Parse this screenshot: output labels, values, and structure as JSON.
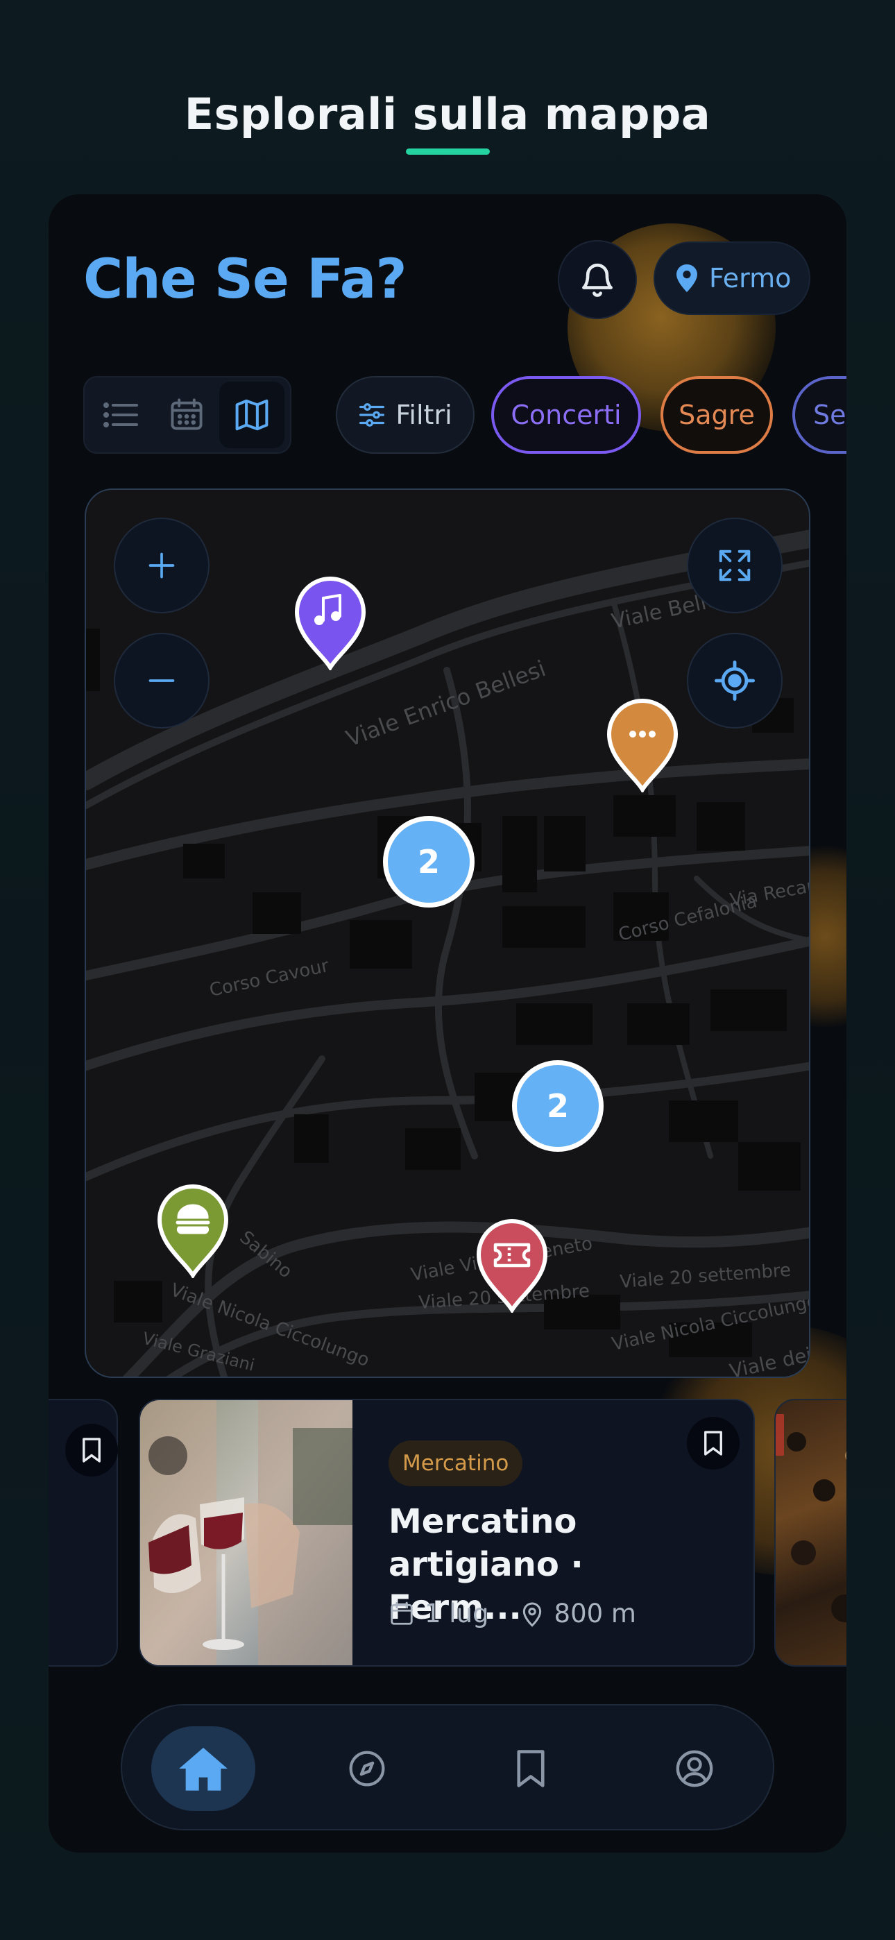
{
  "promo": {
    "headline": "Esplorali sulla mappa"
  },
  "header": {
    "app_title": "Che Se Fa?",
    "location_label": "Fermo"
  },
  "filters": {
    "filter_button_label": "Filtri",
    "categories": [
      {
        "label": "Concerti",
        "color": "#7a5af0"
      },
      {
        "label": "Sagre",
        "color": "#de7c46"
      },
      {
        "label": "Se",
        "color": "#5b64c9"
      }
    ]
  },
  "map": {
    "street_labels": [
      "Viale Enrico Bellesi",
      "Viale Bellesi",
      "Corso Cavour",
      "Corso Cefalonia",
      "Via Recanati",
      "Viale Vittorio Veneto",
      "Viale 20 settembre",
      "Viale 20 settembre",
      "Viale Nicola Ciccolungo",
      "Viale Nicola Ciccolungo",
      "Sabino",
      "Viale Graziani",
      "Viale dei"
    ],
    "clusters": [
      {
        "count": "2"
      },
      {
        "count": "2"
      }
    ],
    "pins": [
      {
        "category": "music-icon",
        "color": "#7a54ee"
      },
      {
        "category": "more-icon",
        "color": "#d48a3e"
      },
      {
        "category": "food-icon",
        "color": "#7c9a34"
      },
      {
        "category": "ticket-icon",
        "color": "#c94d5c"
      }
    ]
  },
  "event_card": {
    "tag": "Mercatino",
    "title": "Mercatino artigiano · Ferm...",
    "date": "1 lug",
    "distance": "800 m"
  },
  "colors": {
    "accent": "#5aa9f2",
    "promo_underline": "#25d3a1",
    "cluster": "#64b2f5"
  },
  "bottom_nav": {
    "items": [
      "home-icon",
      "explore-icon",
      "bookmark-icon",
      "profile-icon"
    ],
    "active": "home-icon"
  }
}
